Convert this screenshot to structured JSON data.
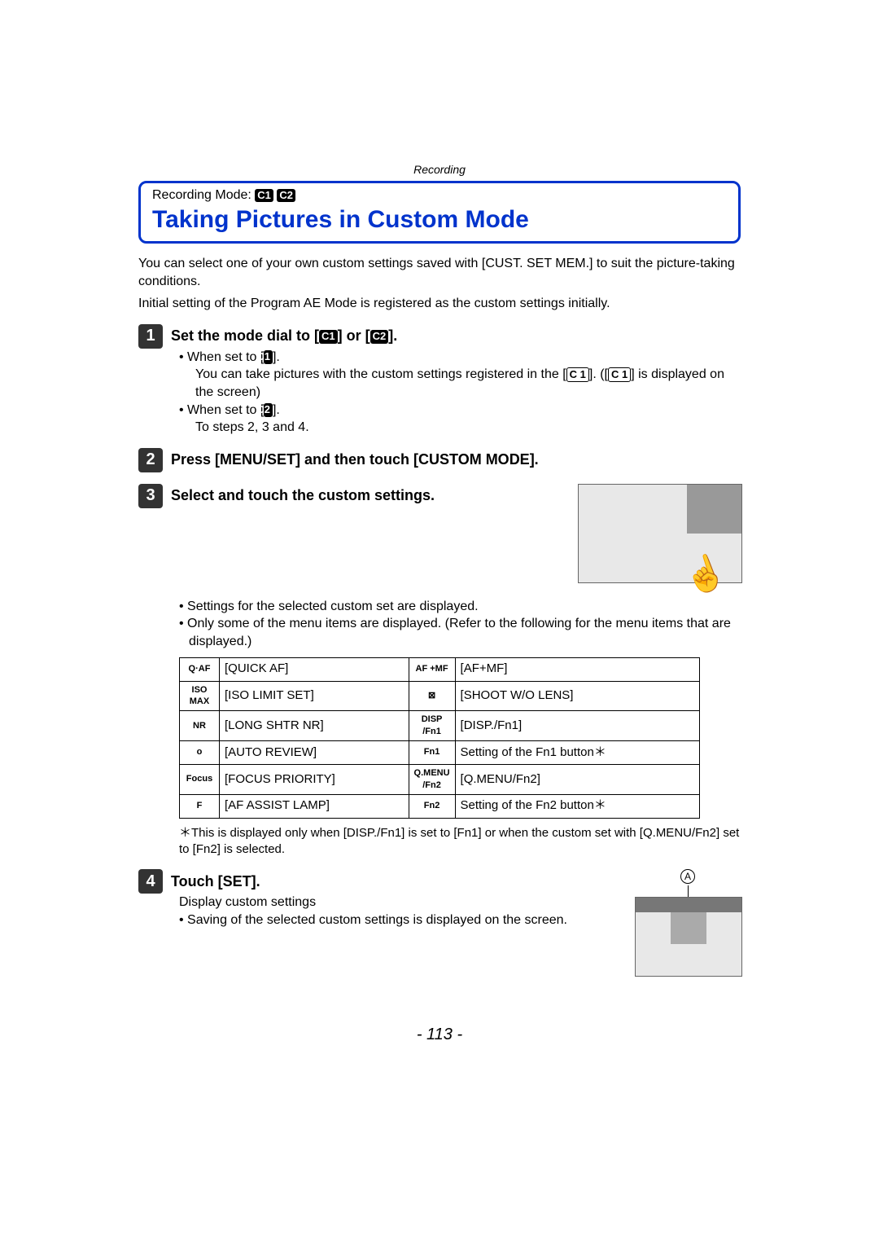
{
  "breadcrumb": "Recording",
  "recording_mode_label": "Recording Mode:",
  "mode_icons": [
    "C1",
    "C2"
  ],
  "title": "Taking Pictures in Custom Mode",
  "intro1": "You can select one of your own custom settings saved with [CUST. SET MEM.] to suit the picture-taking conditions.",
  "intro2": "Initial setting of the Program AE Mode is registered as the custom settings initially.",
  "steps": {
    "s1": {
      "num": "1",
      "title_pre": "Set the mode dial to [",
      "title_mid": "] or [",
      "title_post": "].",
      "c1": "C1",
      "c2": "C2",
      "b1_pre": "• When set to [",
      "b1_icon": "C1",
      "b1_post": "].",
      "sub1_a": "You can take pictures with the custom settings registered in the [",
      "sub1_b": "]. ([",
      "sub1_c": "] is displayed on the screen)",
      "sub1_icon": "C 1",
      "b2_pre": "• When set to [",
      "b2_icon": "C2",
      "b2_post": "].",
      "sub2": "To steps 2, 3 and 4."
    },
    "s2": {
      "num": "2",
      "title": "Press [MENU/SET] and then touch [CUSTOM MODE]."
    },
    "s3": {
      "num": "3",
      "title": "Select and touch the custom settings.",
      "b1": "• Settings for the selected custom set are displayed.",
      "b2": "• Only some of the menu items are displayed. (Refer to the following for the menu items that are displayed.)",
      "footnote": "＊This is displayed only when [DISP./Fn1] is set to [Fn1] or when the custom set with [Q.MENU/Fn2] set to [Fn2] is selected."
    },
    "s4": {
      "num": "4",
      "title": "Touch [SET].",
      "sub_label_A": "A",
      "sub1": "Display custom settings",
      "b1": "• Saving of the selected custom settings is displayed on the screen."
    }
  },
  "menu_table": {
    "left": [
      {
        "icon": "Q·AF",
        "label": "[QUICK AF]"
      },
      {
        "icon": "ISO MAX",
        "label": "[ISO LIMIT SET]"
      },
      {
        "icon": "NR",
        "label": "[LONG SHTR NR]"
      },
      {
        "icon": "o",
        "label": "[AUTO REVIEW]"
      },
      {
        "icon": "Focus",
        "label": "[FOCUS PRIORITY]"
      },
      {
        "icon": "F",
        "label": "[AF ASSIST LAMP]"
      }
    ],
    "right": [
      {
        "icon": "AF +MF",
        "label": "[AF+MF]"
      },
      {
        "icon": "⊠",
        "label": "[SHOOT W/O LENS]"
      },
      {
        "icon": "DISP /Fn1",
        "label": "[DISP./Fn1]"
      },
      {
        "icon": "Fn1",
        "label": "Setting of the Fn1 button＊"
      },
      {
        "icon": "Q.MENU /Fn2",
        "label": "[Q.MENU/Fn2]"
      },
      {
        "icon": "Fn2",
        "label": "Setting of the Fn2 button＊"
      }
    ]
  },
  "page_number": "- 113 -"
}
